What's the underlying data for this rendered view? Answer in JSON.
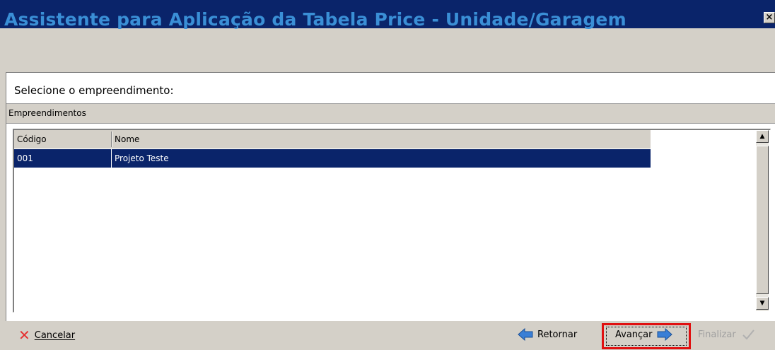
{
  "window": {
    "close_glyph": "✕"
  },
  "header": {
    "title": "Assistente para Aplicação da Tabela Price - Unidade/Garagem"
  },
  "prompt": "Selecione o empreendimento:",
  "group": {
    "label": "Empreendimentos"
  },
  "grid": {
    "columns": [
      "Código",
      "Nome"
    ],
    "rows": [
      {
        "codigo": "001",
        "nome": "Projeto Teste",
        "selected": true
      }
    ]
  },
  "footer": {
    "cancel": {
      "label": "Cancelar",
      "icon": "x-icon"
    },
    "back": {
      "label": "Retornar",
      "icon": "arrow-left-icon"
    },
    "next": {
      "label": "Avançar",
      "icon": "arrow-right-icon"
    },
    "finish": {
      "label": "Finalizar",
      "icon": "check-icon",
      "enabled": false
    }
  },
  "colors": {
    "title_bar": "#0a246a",
    "title_text": "#3a8fd6",
    "selection": "#0a246a",
    "highlight_border": "#e01010",
    "icon_blue": "#3a7fd6",
    "cancel_red": "#e53030"
  }
}
